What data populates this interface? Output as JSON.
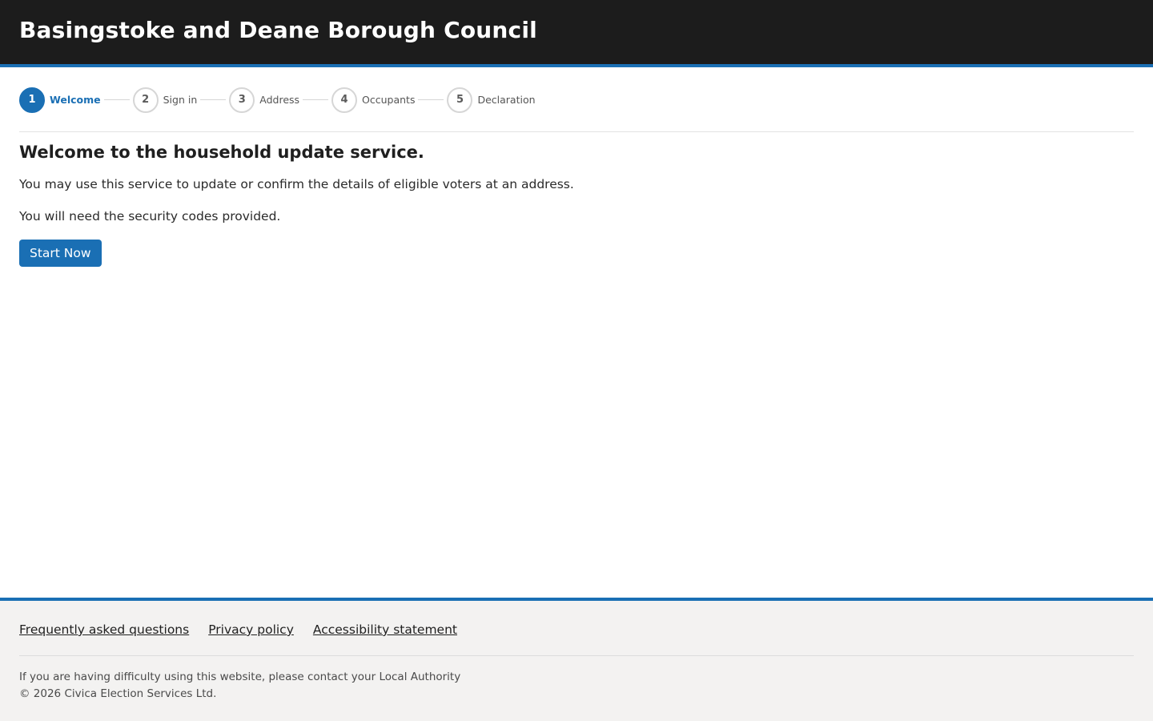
{
  "header": {
    "title": "Basingstoke and Deane Borough Council"
  },
  "steps": [
    {
      "number": "1",
      "label": "Welcome",
      "active": true
    },
    {
      "number": "2",
      "label": "Sign in",
      "active": false
    },
    {
      "number": "3",
      "label": "Address",
      "active": false
    },
    {
      "number": "4",
      "label": "Occupants",
      "active": false
    },
    {
      "number": "5",
      "label": "Declaration",
      "active": false
    }
  ],
  "content": {
    "heading": "Welcome to the household update service.",
    "paragraph1": "You may use this service to update or confirm the details of eligible voters at an address.",
    "paragraph2": "You will need the security codes provided.",
    "start_button": "Start Now"
  },
  "footer": {
    "links": [
      "Frequently asked questions",
      "Privacy policy",
      "Accessibility statement"
    ],
    "help_text": "If you are having difficulty using this website, please contact your Local Authority",
    "copyright": "© 2026 Civica Election Services Ltd."
  },
  "colors": {
    "accent": "#1a6fb4",
    "header_bg": "#1c1c1c",
    "footer_bg": "#f3f2f1"
  }
}
